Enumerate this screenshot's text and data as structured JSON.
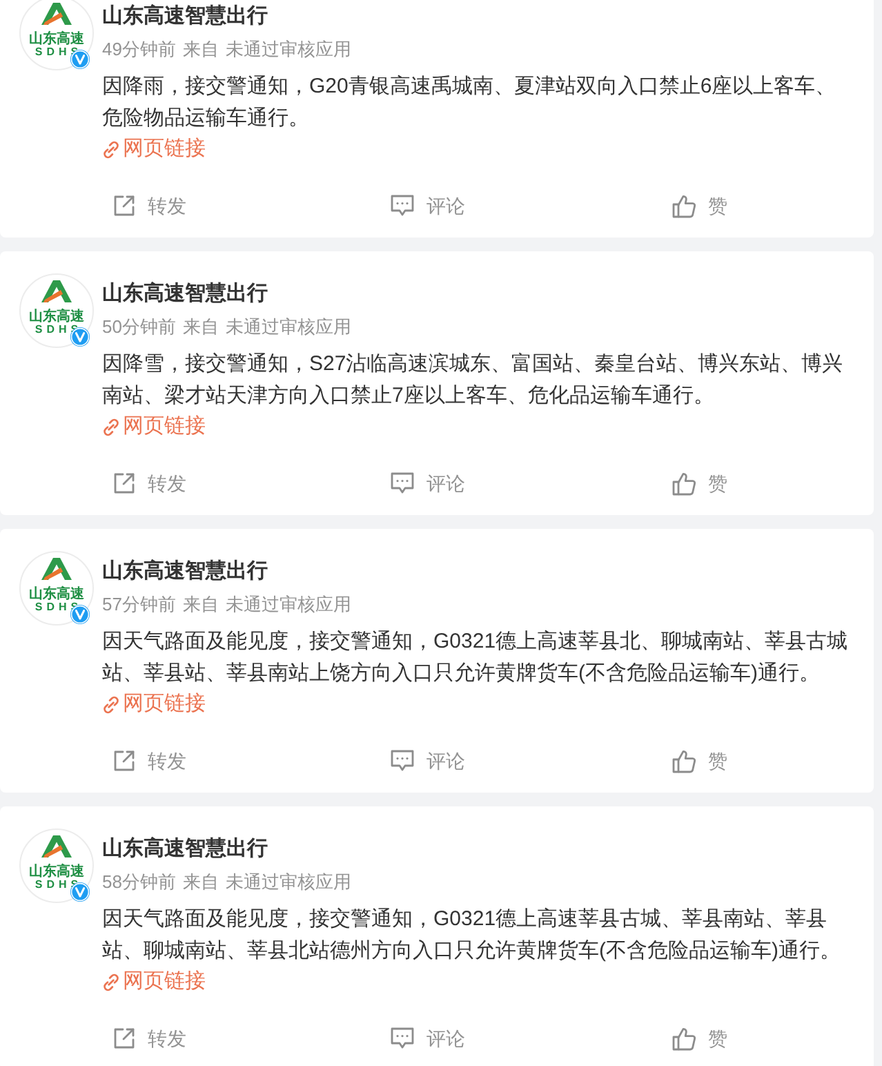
{
  "posts": [
    {
      "author": "山东高速智慧出行",
      "avatar": {
        "logo_text": "山东高速",
        "logo_abbr": "SDHS",
        "verified": true
      },
      "time": "49分钟前",
      "source_label": "来自",
      "source": "未通过审核应用",
      "text": "因降雨，接交警通知，G20青银高速禹城南、夏津站双向入口禁止6座以上客车、危险物品运输车通行。",
      "link": "网页链接",
      "actions": [
        {
          "kind": "repost",
          "label": "转发"
        },
        {
          "kind": "comment",
          "label": "评论"
        },
        {
          "kind": "like",
          "label": "赞"
        }
      ]
    },
    {
      "author": "山东高速智慧出行",
      "avatar": {
        "logo_text": "山东高速",
        "logo_abbr": "SDHS",
        "verified": true
      },
      "time": "50分钟前",
      "source_label": "来自",
      "source": "未通过审核应用",
      "text": "因降雪，接交警通知，S27沾临高速滨城东、富国站、秦皇台站、博兴东站、博兴南站、梁才站天津方向入口禁止7座以上客车、危化品运输车通行。",
      "link": "网页链接",
      "actions": [
        {
          "kind": "repost",
          "label": "转发"
        },
        {
          "kind": "comment",
          "label": "评论"
        },
        {
          "kind": "like",
          "label": "赞"
        }
      ]
    },
    {
      "author": "山东高速智慧出行",
      "avatar": {
        "logo_text": "山东高速",
        "logo_abbr": "SDHS",
        "verified": true
      },
      "time": "57分钟前",
      "source_label": "来自",
      "source": "未通过审核应用",
      "text": "因天气路面及能见度，接交警通知，G0321德上高速莘县北、聊城南站、莘县古城站、莘县站、莘县南站上饶方向入口只允许黄牌货车(不含危险品运输车)通行。",
      "link": "网页链接",
      "actions": [
        {
          "kind": "repost",
          "label": "转发"
        },
        {
          "kind": "comment",
          "label": "评论"
        },
        {
          "kind": "like",
          "label": "赞"
        }
      ]
    },
    {
      "author": "山东高速智慧出行",
      "avatar": {
        "logo_text": "山东高速",
        "logo_abbr": "SDHS",
        "verified": true
      },
      "time": "58分钟前",
      "source_label": "来自",
      "source": "未通过审核应用",
      "text": "因天气路面及能见度，接交警通知，G0321德上高速莘县古城、莘县南站、莘县站、聊城南站、莘县北站德州方向入口只允许黄牌货车(不含危险品运输车)通行。",
      "link": "网页链接",
      "actions": [
        {
          "kind": "repost",
          "label": "转发"
        },
        {
          "kind": "comment",
          "label": "评论"
        },
        {
          "kind": "like",
          "label": "赞"
        }
      ]
    }
  ]
}
